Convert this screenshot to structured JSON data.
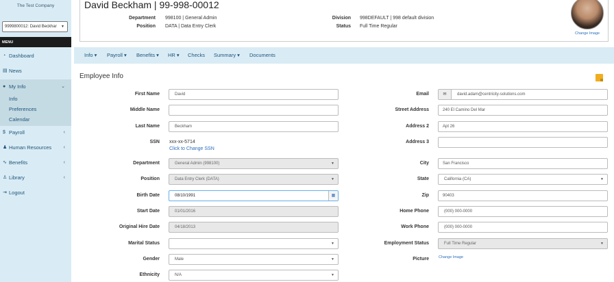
{
  "sidebar": {
    "company": "The Test Company",
    "employee_select": "9999800012: David Beckhar",
    "menu_label": "MENU",
    "items": [
      {
        "label": "Dashboard",
        "icon": "dashboard-icon"
      },
      {
        "label": "News",
        "icon": "newspaper-icon"
      },
      {
        "label": "My Info",
        "icon": "user-icon"
      },
      {
        "label": "Payroll",
        "icon": "dollar-icon"
      },
      {
        "label": "Human Resources",
        "icon": "users-icon"
      },
      {
        "label": "Benefits",
        "icon": "pulse-icon"
      },
      {
        "label": "Library",
        "icon": "library-icon"
      },
      {
        "label": "Logout",
        "icon": "logout-icon"
      }
    ],
    "myinfo_sub": [
      "Info",
      "Preferences",
      "Calendar"
    ]
  },
  "header": {
    "name": "David Beckham | 99-998-00012",
    "department_label": "Department",
    "department_value": "998100 | General Admin",
    "position_label": "Position",
    "position_value": "DATA | Data Entry Clerk",
    "division_label": "Division",
    "division_value": "998DEFAULT | 998 default division",
    "status_label": "Status",
    "status_value": "Full Time Regular",
    "change_image": "Change Image"
  },
  "tabs": [
    "Info ▾",
    "Payroll ▾",
    "Benefits ▾",
    "HR ▾",
    "Checks",
    "Summary ▾",
    "Documents"
  ],
  "section_title": "Employee Info",
  "form_left": {
    "first_name": {
      "label": "First Name",
      "value": "David"
    },
    "middle_name": {
      "label": "Middle Name",
      "value": ""
    },
    "last_name": {
      "label": "Last Name",
      "value": "Beckham"
    },
    "ssn": {
      "label": "SSN",
      "value": "xxx-xx-5714",
      "link": "Click to Change SSN"
    },
    "department": {
      "label": "Department",
      "value": "General Admin (998100)"
    },
    "position": {
      "label": "Position",
      "value": "Data Entry Clerk (DATA)"
    },
    "birth_date": {
      "label": "Birth Date",
      "value": "08/10/1991"
    },
    "start_date": {
      "label": "Start Date",
      "value": "01/01/2016"
    },
    "original_hire_date": {
      "label": "Original Hire Date",
      "value": "04/18/2013"
    },
    "marital_status": {
      "label": "Marital Status",
      "value": ""
    },
    "gender": {
      "label": "Gender",
      "value": "Male"
    },
    "ethnicity": {
      "label": "Ethnicity",
      "value": "N/A"
    }
  },
  "form_right": {
    "email": {
      "label": "Email",
      "value": "david.adam@centricity-solutions.com"
    },
    "street_address": {
      "label": "Street Address",
      "value": "240 El Camino Del Mar"
    },
    "address2": {
      "label": "Address 2",
      "value": "Apt 26"
    },
    "address3": {
      "label": "Address 3",
      "value": ""
    },
    "city": {
      "label": "City",
      "value": "San Francisco"
    },
    "state": {
      "label": "State",
      "value": "California (CA)"
    },
    "zip": {
      "label": "Zip",
      "value": "90403"
    },
    "home_phone": {
      "label": "Home Phone",
      "value": "(000) 000-0000"
    },
    "work_phone": {
      "label": "Work Phone",
      "value": "(000) 000-0000"
    },
    "employment_status": {
      "label": "Employment Status",
      "value": "Full Time Regular"
    },
    "picture": {
      "label": "Picture",
      "link": "Change Image"
    }
  }
}
